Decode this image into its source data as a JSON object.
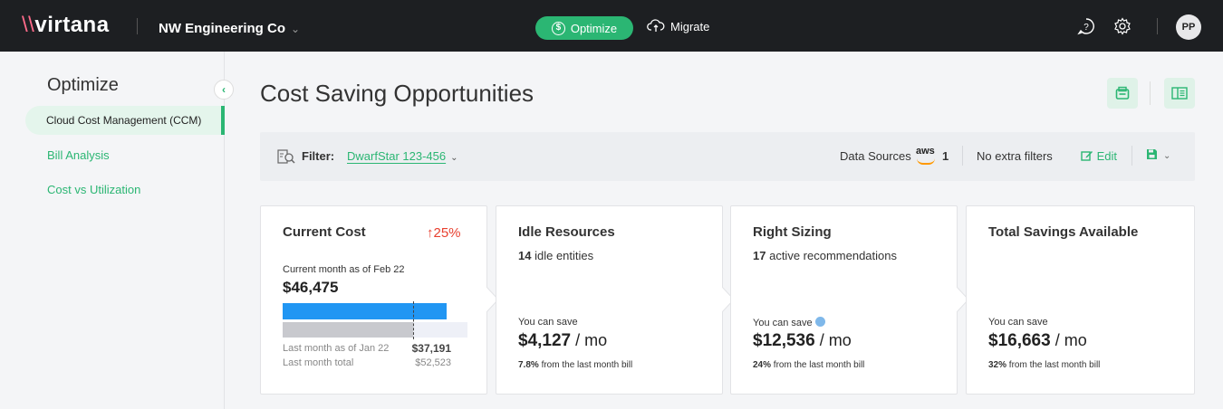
{
  "topbar": {
    "logo": "virtana",
    "org": "NW Engineering Co",
    "optimize_label": "Optimize",
    "migrate_label": "Migrate",
    "avatar_initials": "PP"
  },
  "sidebar": {
    "title": "Optimize",
    "items": [
      {
        "label": "Cloud Cost Management (CCM)",
        "active": true
      },
      {
        "label": "Bill Analysis",
        "active": false
      },
      {
        "label": "Cost vs Utilization",
        "active": false
      }
    ]
  },
  "main": {
    "title": "Cost Saving Opportunities"
  },
  "filter": {
    "label": "Filter:",
    "value": "DwarfStar 123-456",
    "data_sources_label": "Data Sources",
    "source_logo": "aws",
    "source_count": "1",
    "extra_filters": "No extra filters",
    "edit_label": "Edit"
  },
  "cards": {
    "current_cost": {
      "title": "Current Cost",
      "change": "25%",
      "as_of": "Current month as of Feb 22",
      "amount": "$46,475",
      "last_month_label": "Last month as of Jan 22",
      "last_month_value": "$37,191",
      "last_total_label": "Last month total",
      "last_total_value": "$52,523",
      "bar_current_fraction": 0.885,
      "bar_last_fraction": 0.708
    },
    "idle": {
      "title": "Idle Resources",
      "count": "14",
      "count_suffix": "idle entities",
      "save_label": "You can save",
      "save_amount": "$4,127",
      "save_unit": "/ mo",
      "pct": "7.8%",
      "pct_suffix": "from the last month bill"
    },
    "right_sizing": {
      "title": "Right Sizing",
      "count": "17",
      "count_suffix": "active recommendations",
      "save_label": "You can save",
      "save_amount": "$12,536",
      "save_unit": "/ mo",
      "pct": "24%",
      "pct_suffix": "from the last month bill"
    },
    "total": {
      "title": "Total Savings Available",
      "save_label": "You can save",
      "save_amount": "$16,663",
      "save_unit": "/ mo",
      "pct": "32%",
      "pct_suffix": "from the last month bill"
    }
  },
  "colors": {
    "accent": "#2bb673",
    "topbar": "#1d1f22",
    "increase": "#e8402f",
    "bar_current": "#2196f3",
    "bar_last": "#c8c9ce"
  }
}
